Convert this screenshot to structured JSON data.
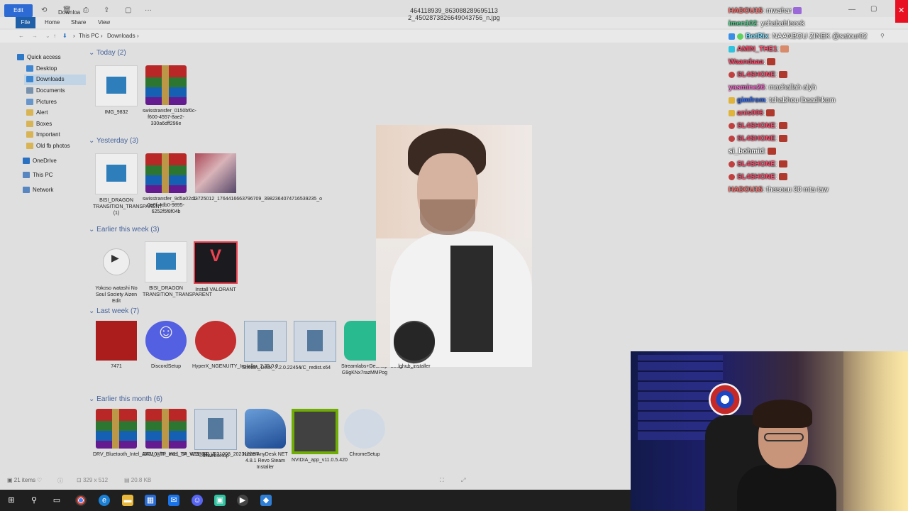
{
  "viewer": {
    "title": "464118939_863088289695113 2_4502873826649043756_n.jpg",
    "edit_label": "Edit",
    "status_items": "21 items",
    "status_dims": "329 x 512",
    "status_size": "20.8 KB"
  },
  "explorer": {
    "tabs": [
      "File",
      "Home",
      "Share",
      "View"
    ],
    "path": [
      "This PC",
      "Downloads"
    ],
    "title_fragment": "Downloa",
    "nav": [
      {
        "label": "Quick access",
        "color": "#2f7fd6"
      },
      {
        "label": "Desktop",
        "color": "#3f8fe0"
      },
      {
        "label": "Downloads",
        "color": "#3f8fe0"
      },
      {
        "label": "Documents",
        "color": "#7f9bb8"
      },
      {
        "label": "Pictures",
        "color": "#6ea0d8"
      },
      {
        "label": "Alert",
        "color": "#e8c15a"
      },
      {
        "label": "Boxes",
        "color": "#e8c15a"
      },
      {
        "label": "Important",
        "color": "#e8c15a"
      },
      {
        "label": "Old fb photos",
        "color": "#e8c15a"
      },
      {
        "label": "OneDrive",
        "color": "#2b78d0"
      },
      {
        "label": "This PC",
        "color": "#5c8fcf"
      },
      {
        "label": "Network",
        "color": "#5c8fcf"
      }
    ],
    "groups": [
      {
        "label": "Today (2)"
      },
      {
        "label": "Yesterday (3)"
      },
      {
        "label": "Earlier this week (3)"
      },
      {
        "label": "Last week (7)"
      },
      {
        "label": "Earlier this month (6)"
      }
    ],
    "files": [
      {
        "name": "IMG_9832",
        "icon": "video-file-icon"
      },
      {
        "name": "swisstransfer_0150bf0c-f600-4557-8ae2-330a6dff296e",
        "icon": "rar-archive-icon"
      },
      {
        "name": "BISI_DRAGON TRANSITION_TRANSPARENT (1)",
        "icon": "video-file-icon"
      },
      {
        "name": "swisstransfer_9d5a02c1-0e8f-4db0-9895-6252f5f8f04b",
        "icon": "rar-archive-icon"
      },
      {
        "name": "13725012_1764416663796709_3982364074716539235_o",
        "icon": "photo-thumbnail-icon"
      },
      {
        "name": "Yokoso watashi No Soul Society Aizen Edit",
        "icon": "media-player-icon"
      },
      {
        "name": "BISI_DRAGON TRANSITION_TRANSPARENT",
        "icon": "video-file-icon"
      },
      {
        "name": "Install VALORANT",
        "icon": "valorant-icon"
      },
      {
        "name": "7471",
        "icon": "red-thumbnail-icon"
      },
      {
        "name": "DiscordSetup",
        "icon": "discord-icon"
      },
      {
        "name": "HyperX_NGENUITY_Installer_2.35.0.0",
        "icon": "hyperx-icon"
      },
      {
        "name": "Stream_Deck_7.2.0.22454",
        "icon": "installer-icon"
      },
      {
        "name": "VC_redist.x64",
        "icon": "installer-icon"
      },
      {
        "name": "Streamlabs+Desktop+Setup+1.19.6-G9gKNx7razMMPog",
        "icon": "streamlabs-icon"
      },
      {
        "name": "lghub_installer",
        "icon": "logitech-icon"
      },
      {
        "name": "DRV_Bluetooth_Intel_AX210_TP_W11_64_V238003_2",
        "icon": "rar-archive-icon"
      },
      {
        "name": "DRV_WiFi_Intel_TP_W11_64_V231008_20231226R",
        "icon": "rar-archive-icon"
      },
      {
        "name": "dxwebsetup",
        "icon": "installer-icon"
      },
      {
        "name": "Ninite AnyDesk NET 4.8.1 Revo Steam Installer",
        "icon": "ninite-icon"
      },
      {
        "name": "NVIDIA_app_v11.0.5.420",
        "icon": "nvidia-icon"
      },
      {
        "name": "ChromeSetup",
        "icon": "cd-installer-icon"
      }
    ]
  },
  "chat": {
    "messages": [
      {
        "user": "HADOU15",
        "user_color": "#ff6a6a",
        "text": ": mwahar"
      },
      {
        "user": "imen102",
        "user_color": "#4fd18b",
        "text": ": ychabahleeek"
      },
      {
        "user": "BotRix",
        "user_color": "#7ee0ff",
        "text": ": NAANBOU ZINEK @satour02"
      },
      {
        "user": "AMIN_THE1",
        "user_color": "#ff4d6d",
        "text": ":"
      },
      {
        "user": "Waandaaa",
        "user_color": "#ff4d6d",
        "text": ":"
      },
      {
        "user": "SL4SHONE",
        "user_color": "#ff4d6d",
        "text": ":"
      },
      {
        "user": "yasmine26",
        "user_color": "#ff6ad5",
        "text": ": machallah alyh"
      },
      {
        "user": "gimfrom",
        "user_color": "#2e6bff",
        "text": ": tchabhou lbaadhkom"
      },
      {
        "user": "anis006",
        "user_color": "#ff4d6d",
        "text": ":"
      },
      {
        "user": "SL4SHONE",
        "user_color": "#ff4d6d",
        "text": ":"
      },
      {
        "user": "SL4SHONE",
        "user_color": "#ff4d6d",
        "text": ":"
      },
      {
        "user": "si_bohmid",
        "user_color": "#ffffff",
        "text": ":"
      },
      {
        "user": "SL4SHONE",
        "user_color": "#ff4d6d",
        "text": ":"
      },
      {
        "user": "SL4SHONE",
        "user_color": "#ff4d6d",
        "text": ":"
      },
      {
        "user": "HADOU15",
        "user_color": "#ff6a6a",
        "text": ": thesouu 30 mta taw"
      }
    ]
  },
  "taskbar": {
    "apps": [
      "start-icon",
      "search-icon",
      "task-view-icon",
      "chrome-icon",
      "edge-icon",
      "file-explorer-icon",
      "store-icon",
      "mail-icon",
      "discord-icon",
      "streamlabs-icon",
      "media-player-icon",
      "app-icon"
    ]
  }
}
